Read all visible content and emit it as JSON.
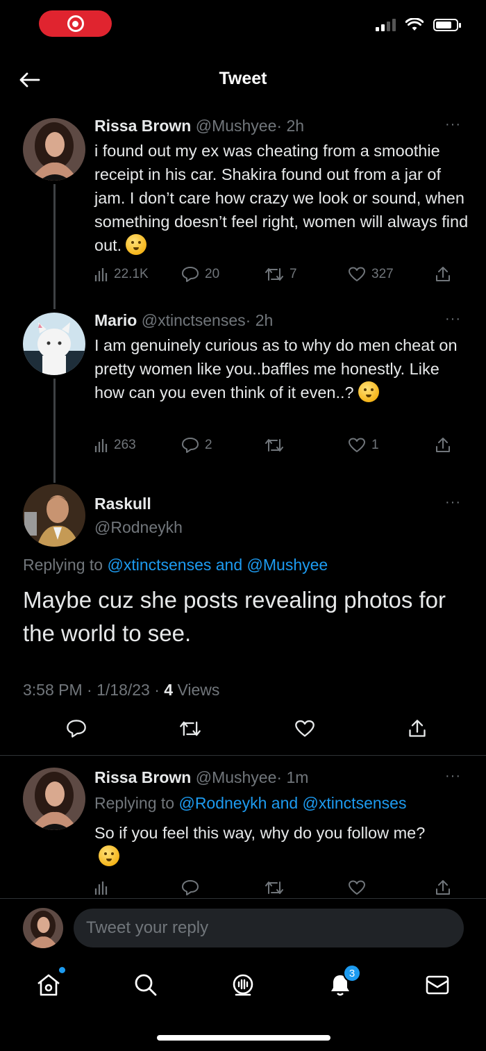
{
  "header": {
    "title": "Tweet"
  },
  "thread": [
    {
      "name": "Rissa Brown",
      "handle": "@Mushyee",
      "time": "· 2h",
      "text": "i found out my ex was cheating from a smoothie receipt in his car. Shakira found out from a jar of jam. I don’t care how crazy we look or sound, when something doesn’t feel right, women will always find out.",
      "stats": {
        "views": "22.1K",
        "replies": "20",
        "retweets": "7",
        "likes": "327"
      }
    },
    {
      "name": "Mario",
      "handle": "@xtinctsenses",
      "time": "· 2h",
      "text": "I am genuinely curious as to why do men cheat on pretty women like you..baffles me honestly. Like how can you even think of it even..?",
      "stats": {
        "views": "263",
        "replies": "2",
        "retweets": "",
        "likes": "1"
      }
    }
  ],
  "main_tweet": {
    "name": "Raskull",
    "handle": "@Rodneykh",
    "replying_prefix": "Replying to",
    "replying_mention_1": "@xtinctsenses",
    "replying_and": "and",
    "replying_mention_2": "@Mushyee",
    "text": "Maybe cuz she posts revealing photos for the world to see.",
    "timestamp": "3:58 PM · 1/18/23 ·",
    "views_count": "4",
    "views_label": "Views"
  },
  "reply": {
    "name": "Rissa Brown",
    "handle": "@Mushyee",
    "time": "· 1m",
    "replying_prefix": "Replying to",
    "replying_mention_1": "@Rodneykh",
    "replying_and": "and",
    "replying_mention_2": "@xtinctsenses",
    "text": "So if you feel this way, why do you follow me?"
  },
  "more_label": "···",
  "reply_bar": {
    "placeholder": "Tweet your reply"
  },
  "nav": {
    "notifications_badge": "3"
  },
  "colors": {
    "background": "#000000",
    "accent": "#1d9bf0",
    "muted": "#71767b",
    "record": "#e0242f"
  }
}
